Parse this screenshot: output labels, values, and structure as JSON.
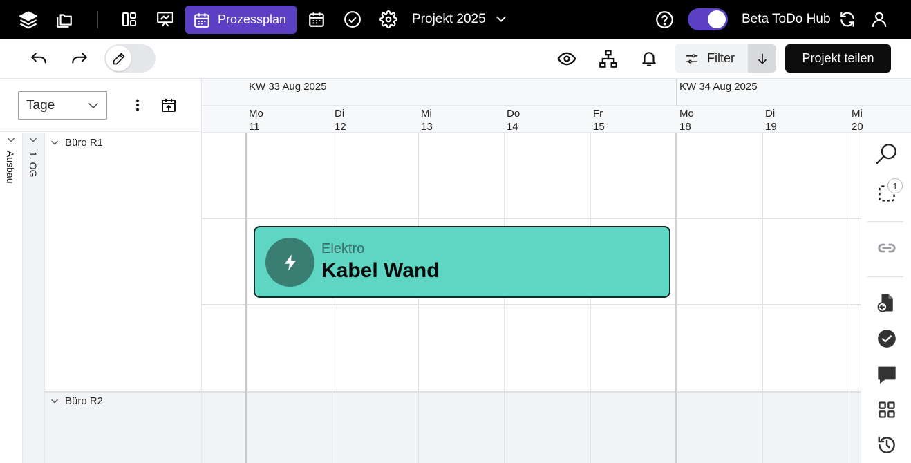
{
  "topbar": {
    "icons": [
      "layers-icon",
      "folders-icon",
      "layout-icon",
      "presentation-icon",
      "calendar-icon",
      "check-circle-icon",
      "settings-icon"
    ],
    "active_tab": {
      "icon": "calendar-icon",
      "label": "Prozessplan"
    },
    "project": {
      "label": "Projekt 2025",
      "icon": "chevron-down-icon"
    },
    "help_icon": "help-circle-icon",
    "toggle_on": true,
    "hub_label": "Beta ToDo Hub",
    "refresh_icon": "refresh-icon",
    "user_icon": "user-icon"
  },
  "toolbar": {
    "undo_icon": "undo-icon",
    "redo_icon": "redo-icon",
    "edit_icon": "pencil-icon",
    "view_icon": "eye-icon",
    "hierarchy_icon": "hierarchy-icon",
    "bell_icon": "bell-icon",
    "filter_label": "Filter",
    "sort_icon": "arrow-down-icon",
    "share_label": "Projekt teilen"
  },
  "controls": {
    "scale_value": "Tage",
    "more_icon": "kebab-icon",
    "today_icon": "calendar-today-icon"
  },
  "timeline": {
    "weeks": [
      {
        "label": "KW 33 Aug 2025"
      },
      {
        "label": "KW 34 Aug 2025"
      }
    ],
    "days": [
      {
        "dow": "Mo",
        "date": "11"
      },
      {
        "dow": "Di",
        "date": "12"
      },
      {
        "dow": "Mi",
        "date": "13"
      },
      {
        "dow": "Do",
        "date": "14"
      },
      {
        "dow": "Fr",
        "date": "15"
      },
      {
        "dow": "Mo",
        "date": "18"
      },
      {
        "dow": "Di",
        "date": "19"
      },
      {
        "dow": "Mi",
        "date": "20"
      }
    ]
  },
  "tree": {
    "group": "Ausbau",
    "level": "1. OG",
    "rooms": [
      {
        "label": "Büro R1"
      },
      {
        "label": "Büro R2"
      }
    ]
  },
  "task": {
    "category": "Elektro",
    "title": "Kabel Wand",
    "icon": "lightning-icon",
    "color": "#5fd6c4"
  },
  "sidebar": {
    "icons": [
      "search-icon",
      "selection-icon",
      "link-icon",
      "document-import-icon",
      "check-badge-icon",
      "comment-icon",
      "grid-icon",
      "history-icon"
    ],
    "selection_count": "1"
  },
  "colors": {
    "accent": "#5b3fc4",
    "topbar_bg": "#000000",
    "task_icon_bg": "#3a7d73"
  }
}
